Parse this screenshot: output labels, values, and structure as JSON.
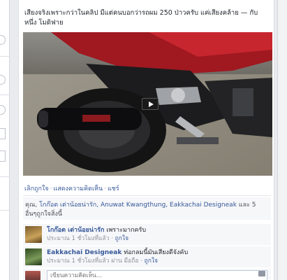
{
  "post": {
    "caption": "เสียงจริงเพราะกว่าในคลิป มีแต่คนบอกว่ารถผม 250 ป่าวครับ แค่เสียงคล้าย — กับ หนึ่ง โมดิฟาย",
    "actions": {
      "like": "เลิกถูกใจ",
      "comment": "แสดงความคิดเห็น",
      "share": "แชร์"
    },
    "likes_summary": {
      "prefix": "คุณ, ",
      "names": "โกก๊อต เต่าน้อยน่ารัก, Anuwat Kwangthung, Eakkachai Designeak",
      "suffix": " และ 5 อื่นๆถูกใจสิ่งนี้"
    },
    "comments": [
      {
        "author": "โกก๊อต เต่าน้อยน่ารัก",
        "text": "เพราะมากครับ",
        "meta_time": "ประมาณ 1 ชั่วโมงที่แล้ว",
        "meta_like": "ถูกใจ"
      },
      {
        "author": "Eakkachai Designeak",
        "text": "ท่อกลมนี้มันเสียงดีจังคับ",
        "meta_time": "ประมาณ 1 ชั่วโมงที่แล้ว ผ่าน มือถือ",
        "meta_like": "ถูกใจ"
      }
    ],
    "write_comment_placeholder": "เขียนความคิดเห็น..."
  },
  "colors": {
    "link": "#365899",
    "muted": "#90949c",
    "page_bg": "#e9ebee"
  },
  "icons": {
    "video_play": "play-icon",
    "camera": "camera-icon"
  }
}
